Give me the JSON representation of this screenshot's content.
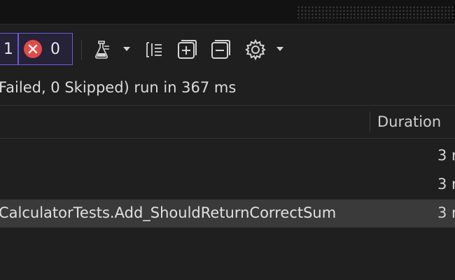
{
  "toolbar": {
    "passed_count": "1",
    "failed_count": "0",
    "icons": {
      "failed_status": "x-circle-icon",
      "playlist": "flask-playlist-icon",
      "group_by": "group-by-icon",
      "expand_all": "expand-all-icon",
      "collapse_all": "collapse-all-icon",
      "settings": "gear-icon"
    }
  },
  "summary": {
    "text": "Failed, 0 Skipped) run in 367 ms"
  },
  "grid": {
    "columns": {
      "duration": "Duration"
    },
    "rows": [
      {
        "name": "",
        "duration": "3 r"
      },
      {
        "name": "",
        "duration": "3 r"
      },
      {
        "name": "CalculatorTests.Add_ShouldReturnCorrectSum",
        "duration": "3 r"
      }
    ]
  },
  "colors": {
    "background": "#1f1f1f",
    "badge_border": "#6b5bd6",
    "failed_red": "#e24a4a",
    "selected_row": "#3a3a3a"
  }
}
